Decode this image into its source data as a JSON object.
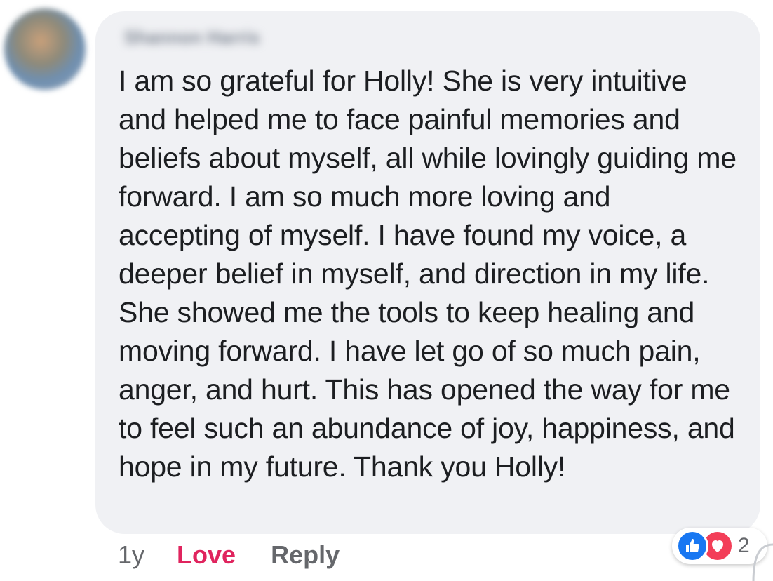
{
  "comment": {
    "author": "Shannon Harris",
    "text": "I am so grateful for Holly! She is very intuitive and helped me to face painful memories and beliefs about myself, all while lovingly guiding me forward. I am so much more loving and accepting of myself. I have found my voice, a deeper belief in myself, and direction in my life. She showed me the tools to keep healing and moving forward. I have let go of so much pain, anger, and hurt. This has opened the way for me to feel such an abundance of joy, happiness, and hope in my future. Thank you Holly!"
  },
  "actions": {
    "time": "1y",
    "love_label": "Love",
    "reply_label": "Reply"
  },
  "reactions": {
    "icons": [
      "thumbs-up-icon",
      "heart-icon"
    ],
    "count": "2"
  },
  "colors": {
    "bubble": "#f0f1f4",
    "text": "#1c1e21",
    "muted": "#65676b",
    "love": "#e0245e",
    "like_icon": "#1877f2",
    "heart_icon": "#f33e58"
  }
}
